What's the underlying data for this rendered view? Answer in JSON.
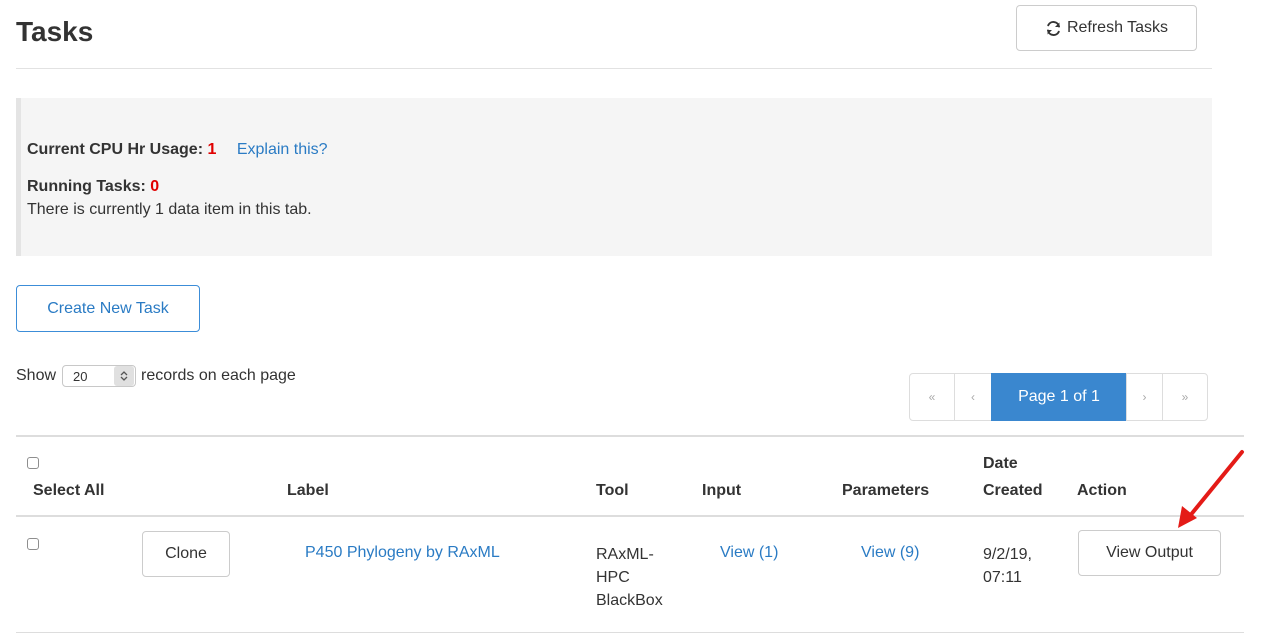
{
  "header": {
    "title": "Tasks",
    "refresh_label": "Refresh Tasks",
    "refresh_icon": "refresh-icon"
  },
  "info": {
    "cpu_label": "Current CPU Hr Usage:",
    "cpu_value": "1",
    "explain_link": "Explain this?",
    "running_label": "Running Tasks:",
    "running_value": "0",
    "data_count_text": "There is currently 1 data item in this tab."
  },
  "create_task_label": "Create New Task",
  "records": {
    "show_label": "Show",
    "selected_value": "20",
    "suffix_label": "records on each page"
  },
  "pagination": {
    "first": "«",
    "prev": "‹",
    "current": "Page 1 of 1",
    "next": "›",
    "last": "»"
  },
  "table": {
    "headers": {
      "select_all": "Select All",
      "label": "Label",
      "tool": "Tool",
      "input": "Input",
      "parameters": "Parameters",
      "date_line1": "Date",
      "date_line2": "Created",
      "action": "Action"
    },
    "rows": [
      {
        "clone_label": "Clone",
        "label": "P450 Phylogeny by RAxML",
        "tool_lines": [
          "RAxML-",
          "HPC",
          "BlackBox"
        ],
        "input": "View (1)",
        "parameters": "View (9)",
        "date_lines": [
          "9/2/19,",
          "07:11"
        ],
        "action_label": "View Output"
      }
    ]
  },
  "colors": {
    "link": "#2a7bc4",
    "primary": "#3a87cf",
    "alert_value": "#e00000",
    "annotation_arrow": "#e41b17",
    "well_background": "#f5f5f5"
  }
}
